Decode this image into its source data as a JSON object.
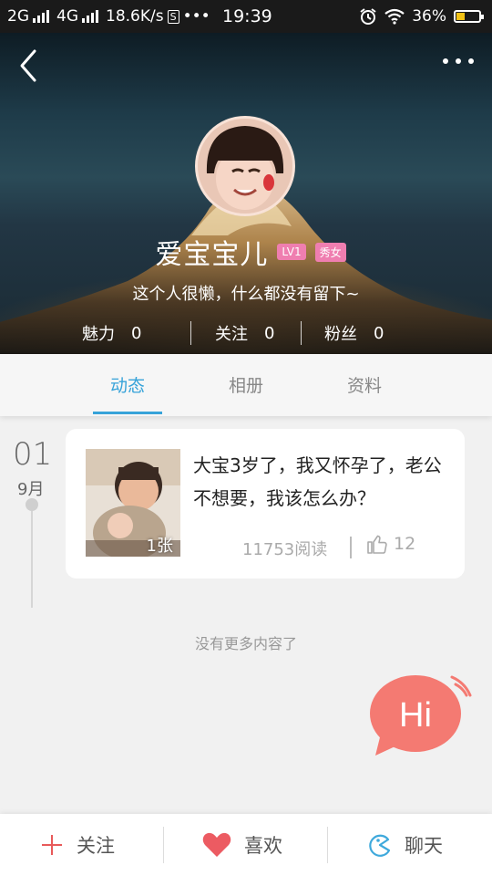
{
  "status_bar": {
    "network1": "2G",
    "network2": "4G",
    "speed": "18.6K/s",
    "s_icon": "S",
    "more": "•••",
    "time": "19:39",
    "battery_percent": "36%",
    "battery_level": 0.36,
    "battery_color": "#f3c316"
  },
  "profile": {
    "name": "爱宝宝儿",
    "badges": [
      "LV1",
      "秀女"
    ],
    "bio": "这个人很懒，什么都没有留下~",
    "stats": [
      {
        "label": "魅力",
        "value": "0"
      },
      {
        "label": "关注",
        "value": "0"
      },
      {
        "label": "粉丝",
        "value": "0"
      }
    ]
  },
  "tabs": [
    {
      "label": "动态",
      "active": true
    },
    {
      "label": "相册",
      "active": false
    },
    {
      "label": "资料",
      "active": false
    }
  ],
  "timeline": {
    "day": "01",
    "month": "9月"
  },
  "post": {
    "title": "大宝3岁了，我又怀孕了，老公不想要，我该怎么办？",
    "image_count": "1张",
    "reads": "11753阅读",
    "likes": "12"
  },
  "no_more_text": "没有更多内容了",
  "hi_text": "Hi",
  "bottom_bar": {
    "follow": "关注",
    "like": "喜欢",
    "chat": "聊天"
  },
  "colors": {
    "accent": "#37a3d9",
    "badge": "#ef7eb0",
    "hi_bubble": "#f47a72",
    "heart": "#ec5b62",
    "follow_plus": "#e85a5a",
    "chat_icon": "#3fa9dc"
  }
}
